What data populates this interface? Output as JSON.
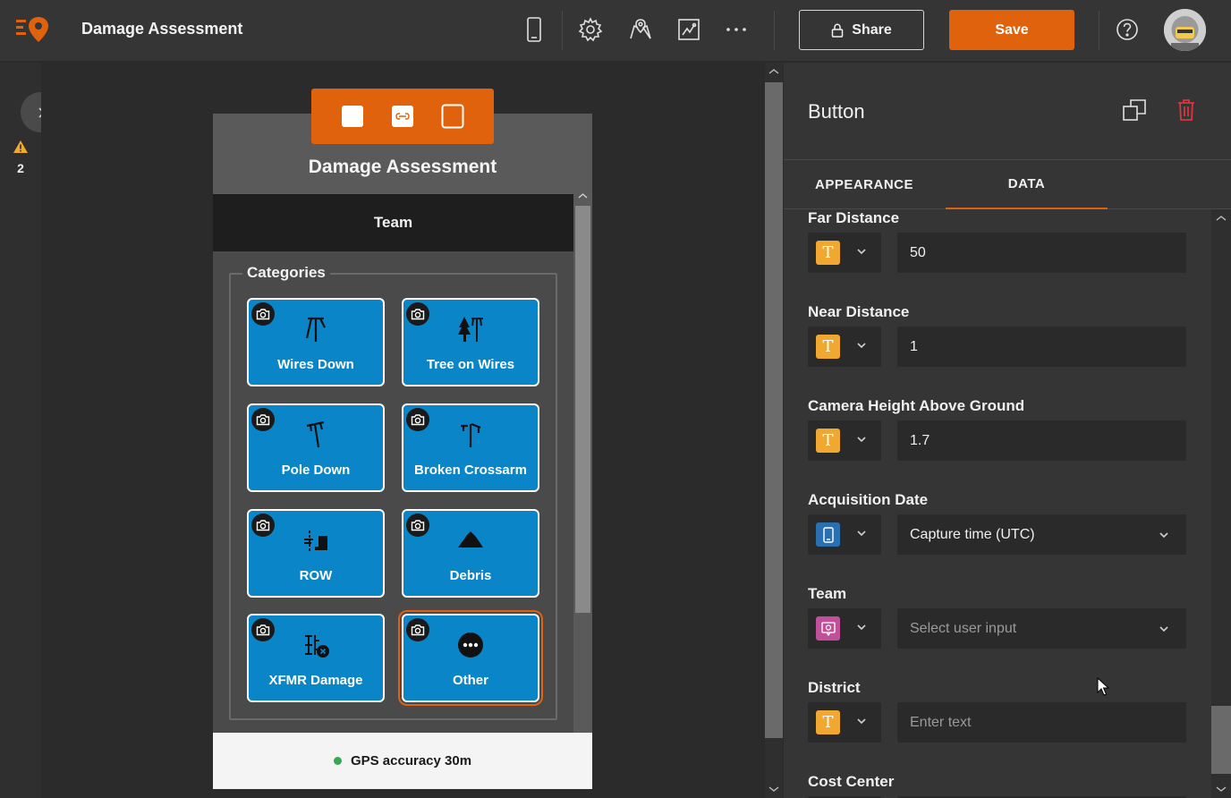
{
  "app": {
    "title": "Damage Assessment",
    "share_label": "Share",
    "save_label": "Save",
    "accent_color": "#e0620d"
  },
  "toolbar_icons": [
    "phone-preview-icon",
    "settings-icon",
    "map-icon",
    "survey-icon",
    "more-icon",
    "help-icon"
  ],
  "left_rail": {
    "warning_count": "2"
  },
  "preview": {
    "form_title": "Damage Assessment",
    "team_label": "Team",
    "group_label": "Categories",
    "tiles": [
      {
        "label": "Wires Down",
        "icon": "wires-down-icon"
      },
      {
        "label": "Tree on Wires",
        "icon": "tree-on-wires-icon"
      },
      {
        "label": "Pole Down",
        "icon": "pole-down-icon"
      },
      {
        "label": "Broken Crossarm",
        "icon": "broken-crossarm-icon"
      },
      {
        "label": "ROW",
        "icon": "row-icon"
      },
      {
        "label": "Debris",
        "icon": "debris-icon"
      },
      {
        "label": "XFMR Damage",
        "icon": "xfmr-damage-icon"
      },
      {
        "label": "Other",
        "icon": "other-icon",
        "selected": true
      }
    ],
    "gps_text": "GPS accuracy 30m"
  },
  "panel": {
    "title": "Button",
    "tabs": [
      {
        "label": "APPEARANCE",
        "active": false
      },
      {
        "label": "DATA",
        "active": true
      }
    ],
    "fields": [
      {
        "label": "Far Distance",
        "type": "text",
        "value": "50",
        "placeholder": ""
      },
      {
        "label": "Near Distance",
        "type": "text",
        "value": "1",
        "placeholder": ""
      },
      {
        "label": "Camera Height Above Ground",
        "type": "text",
        "value": "1.7",
        "placeholder": ""
      },
      {
        "label": "Acquisition Date",
        "type": "device",
        "value": "Capture time (UTC)",
        "placeholder": ""
      },
      {
        "label": "Team",
        "type": "user-input",
        "value": "",
        "placeholder": "Select user input"
      },
      {
        "label": "District",
        "type": "text",
        "value": "",
        "placeholder": "Enter text"
      },
      {
        "label": "Cost Center",
        "type": "text",
        "value": "",
        "placeholder": ""
      }
    ]
  }
}
